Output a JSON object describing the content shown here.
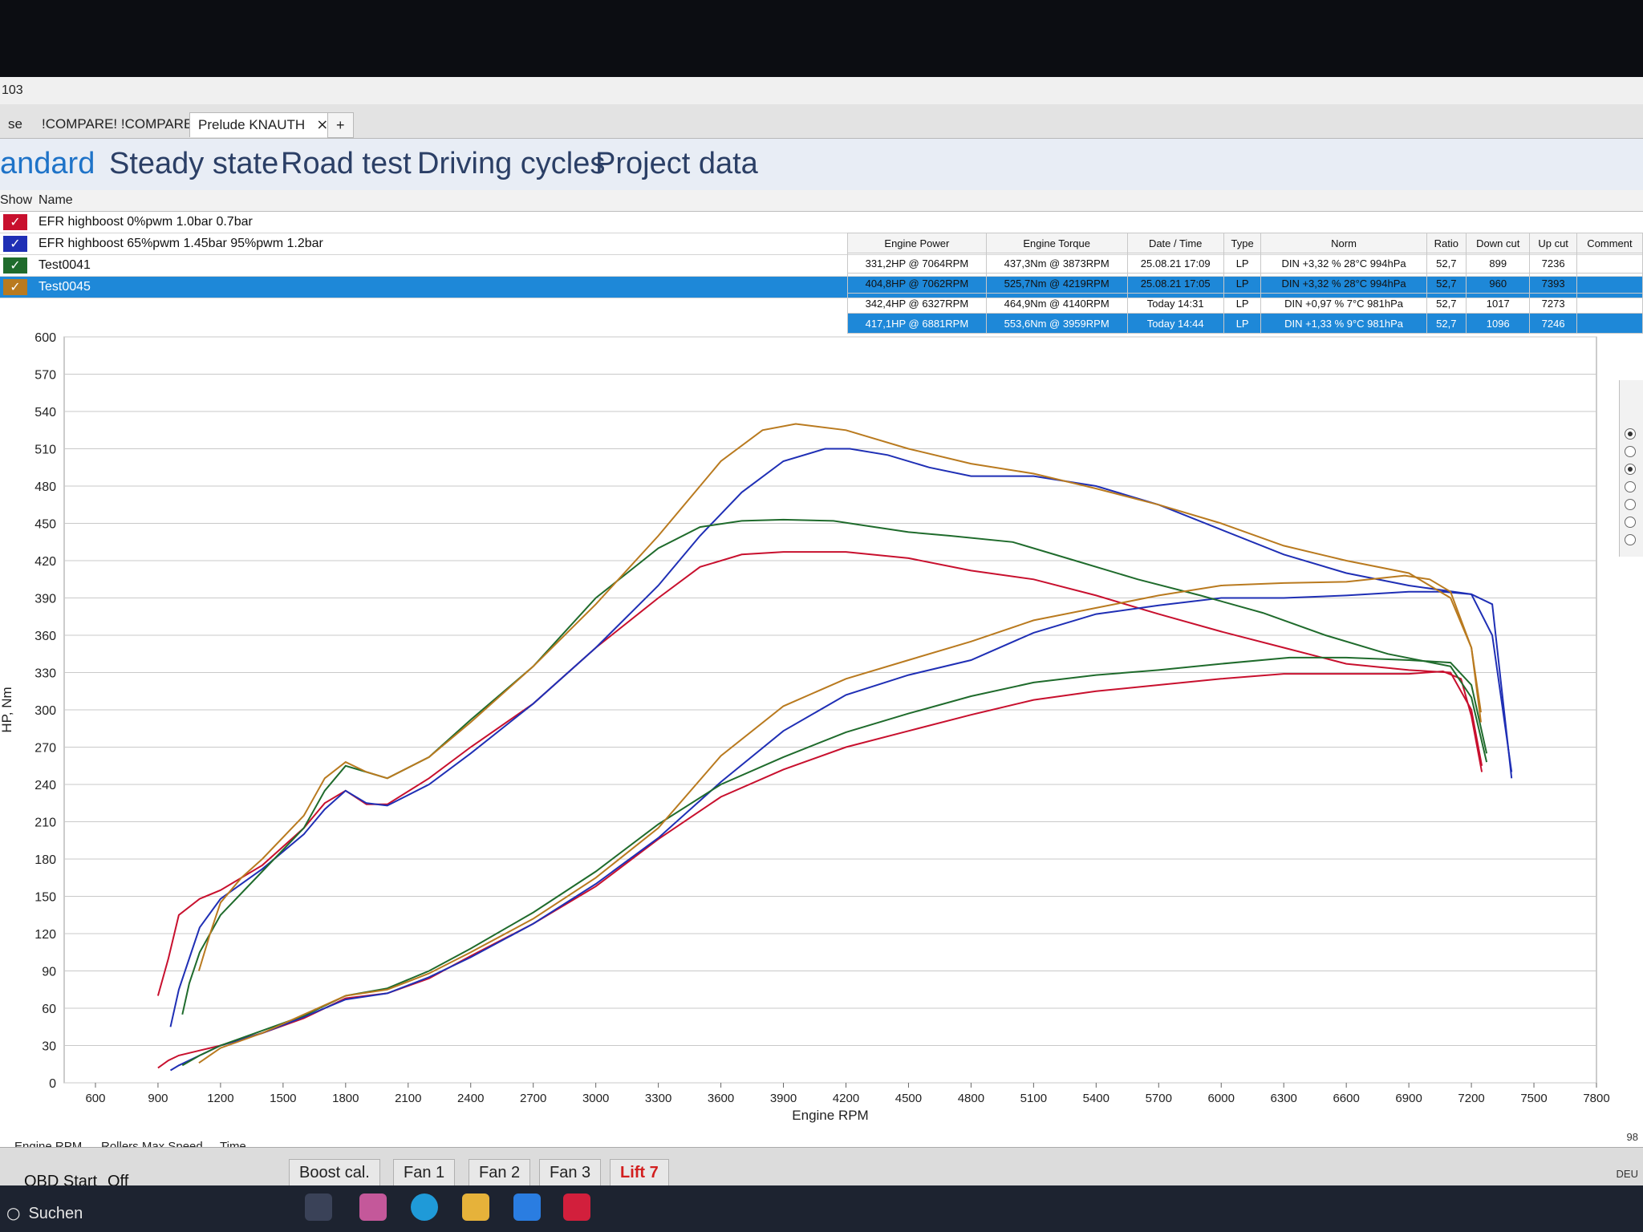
{
  "window": {
    "title": "103"
  },
  "tabs": [
    {
      "label": "se"
    },
    {
      "label": "!COMPARE! !COMPARE!"
    },
    {
      "label": "Prelude KNAUTH",
      "close": "×"
    },
    {
      "label": "+"
    }
  ],
  "nav": [
    "andard",
    "Steady state",
    "Road test",
    "Driving cycles",
    "Project data"
  ],
  "runs_header": {
    "show": "Show",
    "name": "Name"
  },
  "runs": [
    {
      "name": "EFR highboost 0%pwm 1.0bar 0.7bar",
      "color": "#c8102e",
      "checked": "✓"
    },
    {
      "name": "EFR highboost 65%pwm 1.45bar 95%pwm 1.2bar",
      "color": "#1f2fb5",
      "checked": "✓"
    },
    {
      "name": "Test0041",
      "color": "#1f6b2c",
      "checked": "✓"
    },
    {
      "name": "Test0045",
      "color": "#b97a1f",
      "checked": "✓"
    }
  ],
  "stats": {
    "headers": [
      "Engine Power",
      "Engine Torque",
      "Date / Time",
      "Type",
      "Norm",
      "Ratio",
      "Down cut",
      "Up cut",
      "Comment"
    ],
    "rows": [
      [
        "331,2HP @ 7064RPM",
        "437,3Nm @ 3873RPM",
        "25.08.21 17:09",
        "LP",
        "DIN +3,32 % 28°C 994hPa",
        "52,7",
        "899",
        "7236",
        ""
      ],
      [
        "404,8HP @ 7062RPM",
        "525,7Nm @ 4219RPM",
        "25.08.21 17:05",
        "LP",
        "DIN +3,32 % 28°C 994hPa",
        "52,7",
        "960",
        "7393",
        ""
      ],
      [
        "342,4HP @ 6327RPM",
        "464,9Nm @ 4140RPM",
        "Today 14:31",
        "LP",
        "DIN +0,97 % 7°C 981hPa",
        "52,7",
        "1017",
        "7273",
        ""
      ],
      [
        "417,1HP @ 6881RPM",
        "553,6Nm @ 3959RPM",
        "Today 14:44",
        "LP",
        "DIN +1,33 % 9°C 981hPa",
        "52,7",
        "1096",
        "7246",
        ""
      ]
    ]
  },
  "chart_data": {
    "type": "line",
    "xlabel": "Engine RPM",
    "ylabel": "HP, Nm",
    "xlim": [
      450,
      7800
    ],
    "ylim": [
      0,
      600
    ],
    "xticks": [
      600,
      900,
      1200,
      1500,
      1800,
      2100,
      2400,
      2700,
      3000,
      3300,
      3600,
      3900,
      4200,
      4500,
      4800,
      5100,
      5400,
      5700,
      6000,
      6300,
      6600,
      6900,
      7200,
      7500,
      7800
    ],
    "yticks": [
      0,
      30,
      60,
      90,
      120,
      150,
      180,
      210,
      240,
      270,
      300,
      330,
      360,
      390,
      420,
      450,
      480,
      510,
      540,
      570,
      600
    ],
    "grid": true,
    "series": [
      {
        "name": "EFR highboost 0%pwm 1.0bar 0.7bar",
        "color": "#c8102e",
        "kind": "torque",
        "x": [
          900,
          950,
          1000,
          1100,
          1200,
          1400,
          1600,
          1700,
          1800,
          1900,
          2000,
          2200,
          2400,
          2700,
          3000,
          3300,
          3500,
          3700,
          3900,
          4200,
          4500,
          4800,
          5100,
          5400,
          5700,
          6000,
          6300,
          6600,
          6900,
          7100,
          7200,
          7250
        ],
        "y": [
          70,
          100,
          135,
          148,
          155,
          175,
          205,
          225,
          235,
          224,
          224,
          245,
          270,
          305,
          350,
          390,
          415,
          425,
          427,
          427,
          422,
          412,
          405,
          392,
          377,
          363,
          350,
          337,
          332,
          330,
          300,
          255
        ]
      },
      {
        "name": "EFR highboost 0%pwm 1.0bar 0.7bar",
        "color": "#c8102e",
        "kind": "power",
        "x": [
          900,
          950,
          1000,
          1100,
          1200,
          1400,
          1600,
          1800,
          2000,
          2200,
          2400,
          2700,
          3000,
          3300,
          3600,
          3900,
          4200,
          4500,
          4800,
          5100,
          5400,
          5700,
          6000,
          6300,
          6600,
          6900,
          7064,
          7150,
          7200,
          7250
        ],
        "y": [
          12,
          18,
          22,
          26,
          30,
          40,
          52,
          68,
          72,
          84,
          102,
          128,
          158,
          196,
          230,
          252,
          270,
          283,
          296,
          308,
          315,
          320,
          325,
          329,
          329,
          329,
          331,
          325,
          295,
          250
        ]
      },
      {
        "name": "EFR highboost 65%pwm 1.45bar 95%pwm 1.2bar",
        "color": "#1f2fb5",
        "kind": "torque",
        "x": [
          960,
          1000,
          1050,
          1100,
          1200,
          1400,
          1600,
          1700,
          1800,
          1900,
          2000,
          2200,
          2400,
          2700,
          3000,
          3300,
          3500,
          3700,
          3900,
          4100,
          4219,
          4400,
          4600,
          4800,
          5100,
          5400,
          5700,
          6000,
          6300,
          6600,
          6900,
          7200,
          7300,
          7393
        ],
        "y": [
          45,
          75,
          100,
          125,
          148,
          172,
          200,
          220,
          235,
          225,
          223,
          240,
          265,
          305,
          350,
          400,
          440,
          475,
          500,
          510,
          510,
          505,
          495,
          488,
          488,
          480,
          465,
          445,
          425,
          410,
          400,
          393,
          385,
          245
        ]
      },
      {
        "name": "EFR highboost 65%pwm 1.45bar 95%pwm 1.2bar",
        "color": "#1f2fb5",
        "kind": "power",
        "x": [
          960,
          1000,
          1100,
          1200,
          1400,
          1600,
          1800,
          2000,
          2200,
          2400,
          2700,
          3000,
          3300,
          3600,
          3900,
          4200,
          4500,
          4800,
          5100,
          5400,
          5700,
          6000,
          6300,
          6600,
          6900,
          7062,
          7200,
          7300,
          7393
        ],
        "y": [
          10,
          14,
          22,
          30,
          40,
          53,
          67,
          72,
          85,
          101,
          128,
          160,
          197,
          242,
          283,
          312,
          328,
          340,
          362,
          377,
          384,
          390,
          390,
          392,
          395,
          395,
          393,
          360,
          250
        ]
      },
      {
        "name": "Test0041",
        "color": "#1f6b2c",
        "kind": "torque",
        "x": [
          1017,
          1050,
          1100,
          1200,
          1400,
          1600,
          1700,
          1800,
          1900,
          2000,
          2200,
          2400,
          2700,
          3000,
          3300,
          3500,
          3700,
          3900,
          4140,
          4300,
          4500,
          4700,
          5000,
          5300,
          5600,
          5900,
          6200,
          6500,
          6800,
          7100,
          7200,
          7273
        ],
        "y": [
          55,
          80,
          105,
          135,
          170,
          205,
          235,
          255,
          250,
          245,
          262,
          292,
          335,
          390,
          430,
          447,
          452,
          453,
          452,
          448,
          443,
          440,
          435,
          420,
          405,
          392,
          378,
          360,
          345,
          335,
          310,
          258
        ]
      },
      {
        "name": "Test0041",
        "color": "#1f6b2c",
        "kind": "power",
        "x": [
          1017,
          1100,
          1200,
          1400,
          1600,
          1800,
          2000,
          2200,
          2400,
          2700,
          3000,
          3300,
          3600,
          3900,
          4200,
          4500,
          4800,
          5100,
          5400,
          5700,
          6000,
          6327,
          6600,
          6900,
          7100,
          7200,
          7273
        ],
        "y": [
          14,
          22,
          30,
          42,
          54,
          70,
          76,
          90,
          108,
          137,
          170,
          208,
          240,
          262,
          282,
          297,
          311,
          322,
          328,
          332,
          337,
          342,
          342,
          340,
          338,
          320,
          265
        ]
      },
      {
        "name": "Test0045",
        "color": "#b97a1f",
        "kind": "torque",
        "x": [
          1096,
          1150,
          1200,
          1300,
          1400,
          1600,
          1700,
          1800,
          1900,
          2000,
          2200,
          2400,
          2700,
          3000,
          3300,
          3600,
          3800,
          3959,
          4200,
          4500,
          4800,
          5100,
          5400,
          5700,
          6000,
          6300,
          6600,
          6900,
          7100,
          7200,
          7246
        ],
        "y": [
          90,
          120,
          145,
          165,
          180,
          215,
          245,
          258,
          250,
          245,
          262,
          290,
          335,
          385,
          440,
          500,
          525,
          530,
          525,
          510,
          498,
          490,
          478,
          465,
          450,
          432,
          420,
          410,
          390,
          350,
          298
        ]
      },
      {
        "name": "Test0045",
        "color": "#b97a1f",
        "kind": "power",
        "x": [
          1096,
          1200,
          1400,
          1600,
          1800,
          2000,
          2200,
          2400,
          2700,
          3000,
          3300,
          3600,
          3900,
          4200,
          4500,
          4800,
          5100,
          5400,
          5700,
          6000,
          6300,
          6600,
          6881,
          7000,
          7100,
          7200,
          7246
        ],
        "y": [
          16,
          28,
          40,
          55,
          70,
          75,
          88,
          105,
          132,
          165,
          205,
          263,
          303,
          325,
          340,
          355,
          372,
          382,
          392,
          400,
          402,
          403,
          408,
          405,
          395,
          350,
          290
        ]
      }
    ]
  },
  "bottom_tabs": [
    "Engine RPM",
    "Rollers Max Speed",
    "Time"
  ],
  "buttons": [
    "Boost cal.",
    "Fan 1",
    "Fan 2",
    "Fan 3",
    "Lift 7"
  ],
  "obd": {
    "label": "OBD Start",
    "value": "Off"
  },
  "taskbar": {
    "search": "Suchen"
  },
  "tray": {
    "lang": "DEU",
    "number": "98"
  },
  "colors": {
    "selection": "#1e88d8",
    "nav_active": "#1e73c8",
    "accent_red": "#d21f1f"
  }
}
